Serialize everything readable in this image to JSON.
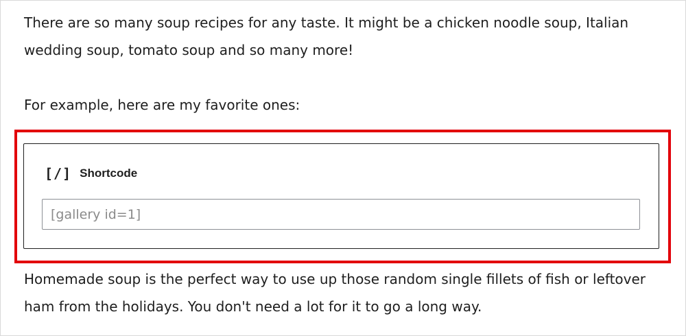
{
  "paragraphs": {
    "intro_line1": "There are so many soup recipes for any taste. It might be a chicken noodle soup, Italian",
    "intro_line2": "wedding soup, tomato soup and so many more!",
    "example_line": "For example, here are my favorite ones:",
    "outro_line1": "Homemade soup is the perfect way to use up those random single fillets of fish or leftover",
    "outro_line2": "ham from the holidays. You don't need a lot for it to go a long way."
  },
  "shortcode_block": {
    "icon": "shortcode-icon",
    "icon_glyph": "[/]",
    "title": "Shortcode",
    "input_value": "",
    "input_placeholder": "[gallery id=1]"
  },
  "colors": {
    "highlight": "#e2000a",
    "text": "#1e1e1e",
    "placeholder": "#8a8a8a"
  }
}
